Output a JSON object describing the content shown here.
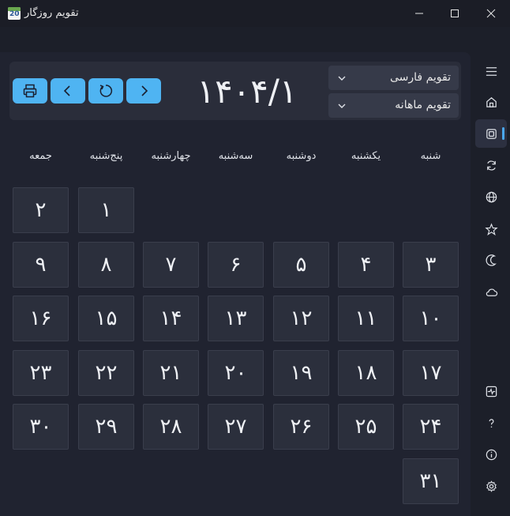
{
  "window": {
    "title": "تقویم روزگار",
    "icon_text": "20"
  },
  "header": {
    "calendar_type": "تقویم فارسی",
    "view_mode": "تقویم ماهانه",
    "current_date": "۱۴۰۴/۱"
  },
  "weekdays": [
    "شنبه",
    "یکشنبه",
    "دوشنبه",
    "سه‌شنبه",
    "چهارشنبه",
    "پنج‌شنبه",
    "جمعه"
  ],
  "days": [
    "۱",
    "۲",
    "۳",
    "۴",
    "۵",
    "۶",
    "۷",
    "۸",
    "۹",
    "۱۰",
    "۱۱",
    "۱۲",
    "۱۳",
    "۱۴",
    "۱۵",
    "۱۶",
    "۱۷",
    "۱۸",
    "۱۹",
    "۲۰",
    "۲۱",
    "۲۲",
    "۲۳",
    "۲۴",
    "۲۵",
    "۲۶",
    "۲۷",
    "۲۸",
    "۲۹",
    "۳۰",
    "۳۱"
  ],
  "sidebar_icons": [
    "menu-icon",
    "home-icon",
    "calendar-icon",
    "sync-icon",
    "globe-icon",
    "star-icon",
    "moon-icon",
    "cloud-icon",
    "activity-icon",
    "help-icon",
    "info-icon",
    "settings-icon"
  ],
  "colors": {
    "accent": "#4fb4f2",
    "background": "#1c1f29",
    "cell": "#2b2f3c"
  }
}
